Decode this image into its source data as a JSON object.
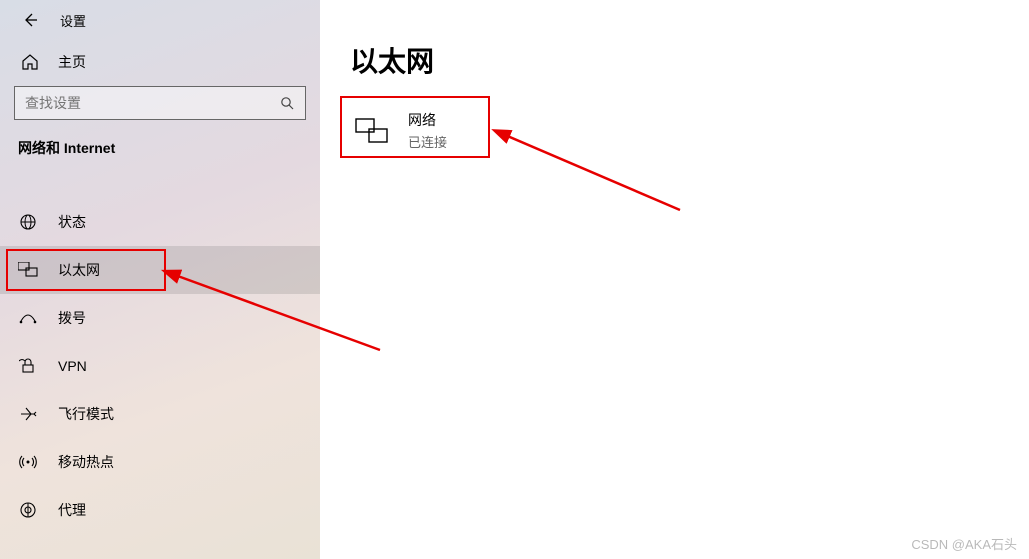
{
  "header": {
    "app_title": "设置"
  },
  "home": {
    "label": "主页"
  },
  "search": {
    "placeholder": "查找设置"
  },
  "category": {
    "title": "网络和 Internet"
  },
  "sidebar": {
    "items": [
      {
        "label": "状态"
      },
      {
        "label": "以太网"
      },
      {
        "label": "拨号"
      },
      {
        "label": "VPN"
      },
      {
        "label": "飞行模式"
      },
      {
        "label": "移动热点"
      },
      {
        "label": "代理"
      }
    ]
  },
  "main": {
    "title": "以太网",
    "network": {
      "name": "网络",
      "status": "已连接"
    }
  },
  "watermark": "CSDN @AKA石头"
}
